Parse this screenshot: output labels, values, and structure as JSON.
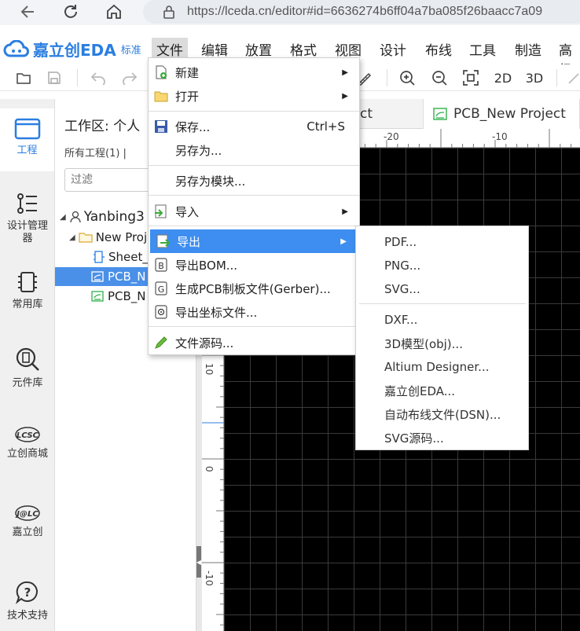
{
  "browser": {
    "url": "https://lceda.cn/editor#id=6636274b6ff04a7ba085f26baacc7a09"
  },
  "app": {
    "logo_text": "嘉立创EDA",
    "logo_sub": "标准"
  },
  "menubar": {
    "items": [
      {
        "label": "文件",
        "active": true
      },
      {
        "label": "编辑"
      },
      {
        "label": "放置"
      },
      {
        "label": "格式"
      },
      {
        "label": "视图"
      },
      {
        "label": "设计"
      },
      {
        "label": "布线"
      },
      {
        "label": "工具"
      },
      {
        "label": "制造"
      },
      {
        "label": "高级"
      }
    ]
  },
  "toolbar": {
    "view_2d": "2D",
    "view_3d": "3D"
  },
  "sidebar": {
    "items": [
      {
        "label": "工程",
        "icon": "folder-icon"
      },
      {
        "label": "设计管理器",
        "icon": "list-icon"
      },
      {
        "label": "常用库",
        "icon": "chip-icon"
      },
      {
        "label": "元件库",
        "icon": "search-chip-icon"
      },
      {
        "label": "立创商城",
        "icon": "lcsc-icon"
      },
      {
        "label": "嘉立创",
        "icon": "jlc-icon"
      },
      {
        "label": "技术支持",
        "icon": "help-icon"
      }
    ]
  },
  "project_panel": {
    "title": "工作区: 个人",
    "sub": "所有工程(1)   |",
    "filter_placeholder": "过滤",
    "tree": [
      {
        "label": "Yanbing3"
      },
      {
        "label": "New Proj"
      },
      {
        "label": "Sheet_"
      },
      {
        "label": "PCB_N"
      },
      {
        "label": "PCB_N"
      }
    ]
  },
  "tabs": [
    {
      "label": "ect"
    },
    {
      "label": "PCB_New Project"
    }
  ],
  "rulers": {
    "top": [
      "-20",
      "-10"
    ],
    "left": [
      "10",
      "0",
      "-10"
    ]
  },
  "file_menu": {
    "items": [
      {
        "label": "新建",
        "icon": "new-file-icon",
        "submenu": true
      },
      {
        "label": "打开",
        "icon": "open-folder-icon",
        "submenu": true
      },
      {
        "label": "保存...",
        "icon": "save-icon",
        "shortcut": "Ctrl+S"
      },
      {
        "label": "另存为..."
      },
      {
        "label": "另存为模块..."
      },
      {
        "label": "导入",
        "icon": "import-icon",
        "submenu": true
      },
      {
        "label": "导出",
        "icon": "export-icon",
        "submenu": true,
        "highlighted": true
      },
      {
        "label": "导出BOM...",
        "icon": "bom-icon"
      },
      {
        "label": "生成PCB制板文件(Gerber)...",
        "icon": "gerber-icon"
      },
      {
        "label": "导出坐标文件...",
        "icon": "coordinate-icon"
      },
      {
        "label": "文件源码...",
        "icon": "pencil-icon"
      }
    ]
  },
  "export_submenu": {
    "items": [
      "PDF...",
      "PNG...",
      "SVG...",
      "DXF...",
      "3D模型(obj)...",
      "Altium Designer...",
      "嘉立创EDA...",
      "自动布线文件(DSN)...",
      "SVG源码..."
    ]
  },
  "colors": {
    "accent": "#2a7ee0",
    "highlight": "#3d8ef0",
    "canvas": "#000000",
    "grid": "#3a3a3a"
  }
}
